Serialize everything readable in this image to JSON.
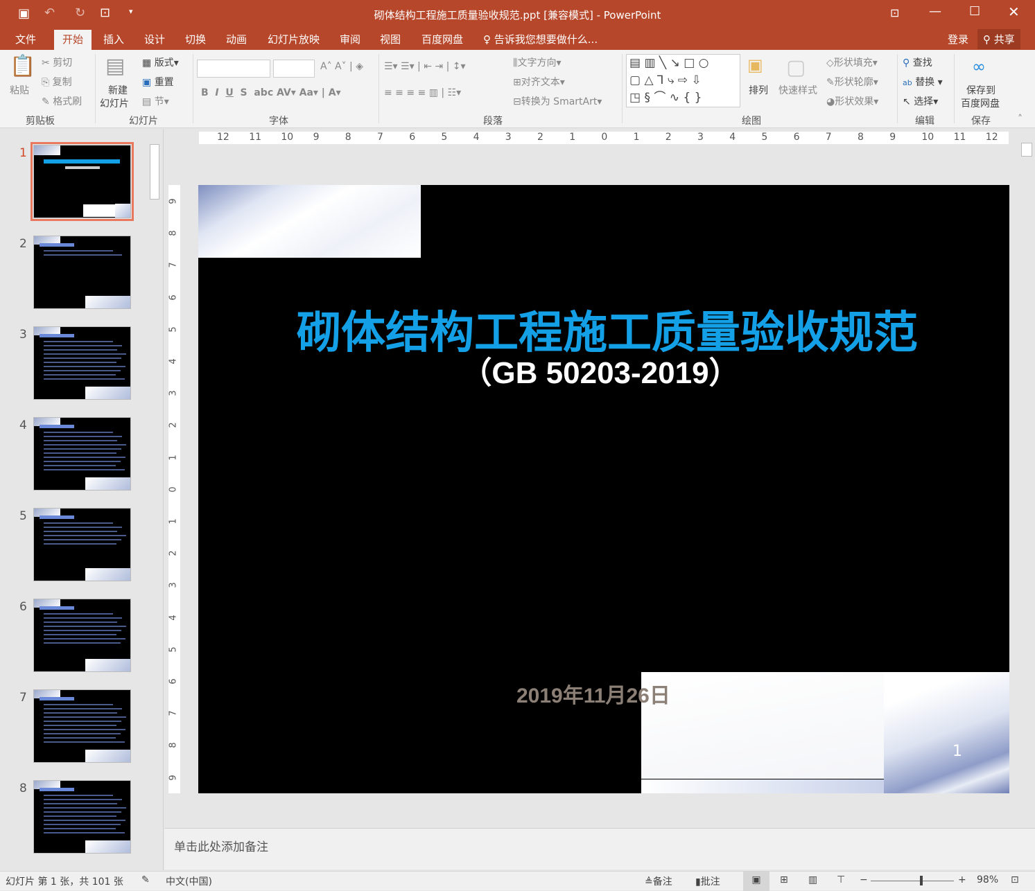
{
  "window": {
    "title": "砌体结构工程施工质量验收规范.ppt [兼容模式] - PowerPoint",
    "qat": [
      "save-icon",
      "undo-icon",
      "redo-icon",
      "start-slideshow-icon",
      "customize-icon"
    ]
  },
  "tabs": [
    {
      "label": "文件"
    },
    {
      "label": "开始",
      "active": true
    },
    {
      "label": "插入"
    },
    {
      "label": "设计"
    },
    {
      "label": "切换"
    },
    {
      "label": "动画"
    },
    {
      "label": "幻灯片放映"
    },
    {
      "label": "审阅"
    },
    {
      "label": "视图"
    },
    {
      "label": "百度网盘"
    }
  ],
  "tell_me": "告诉我您想要做什么...",
  "account": {
    "login": "登录",
    "share": "共享"
  },
  "ribbon": {
    "clipboard": {
      "paste": "粘贴",
      "cut": "剪切",
      "copy": "复制",
      "format_painter": "格式刷",
      "label": "剪贴板"
    },
    "slides": {
      "new_slide_1": "新建",
      "new_slide_2": "幻灯片",
      "layout": "版式",
      "reset": "重置",
      "section": "节",
      "label": "幻灯片"
    },
    "font": {
      "label": "字体",
      "font_name": "",
      "font_size": ""
    },
    "paragraph": {
      "label": "段落",
      "text_direction": "文字方向",
      "align_text": "对齐文本",
      "smartart": "转换为 SmartArt"
    },
    "drawing": {
      "label": "绘图",
      "arrange": "排列",
      "quick_styles": "快速样式",
      "shape_fill": "形状填充",
      "shape_outline": "形状轮廓",
      "shape_effects": "形状效果"
    },
    "editing": {
      "label": "编辑",
      "find": "查找",
      "replace": "替换",
      "select": "选择"
    },
    "save": {
      "label": "保存",
      "save_to_1": "保存到",
      "save_to_2": "百度网盘"
    }
  },
  "ruler_h": [
    "12",
    "11",
    "10",
    "9",
    "8",
    "7",
    "6",
    "5",
    "4",
    "3",
    "2",
    "1",
    "0",
    "1",
    "2",
    "3",
    "4",
    "5",
    "6",
    "7",
    "8",
    "9",
    "10",
    "11",
    "12"
  ],
  "ruler_v": [
    "9",
    "8",
    "7",
    "6",
    "5",
    "4",
    "3",
    "2",
    "1",
    "0",
    "1",
    "2",
    "3",
    "4",
    "5",
    "6",
    "7",
    "8",
    "9"
  ],
  "thumbnails": [
    {
      "n": "1",
      "selected": true
    },
    {
      "n": "2"
    },
    {
      "n": "3"
    },
    {
      "n": "4"
    },
    {
      "n": "5"
    },
    {
      "n": "6"
    },
    {
      "n": "7"
    },
    {
      "n": "8"
    }
  ],
  "slide": {
    "title": "砌体结构工程施工质量验收规范",
    "subtitle": "（GB 50203-2019）",
    "date": "2019年11月26日",
    "page_number": "1",
    "colors": {
      "title": "#14a0e6",
      "date": "#8c8076"
    }
  },
  "notes_placeholder": "单击此处添加备注",
  "status": {
    "slide_info": "幻灯片 第 1 张，共 101 张",
    "language": "中文(中国)",
    "notes": "备注",
    "comments": "批注",
    "zoom": "98%",
    "zoom_percent": 98
  }
}
